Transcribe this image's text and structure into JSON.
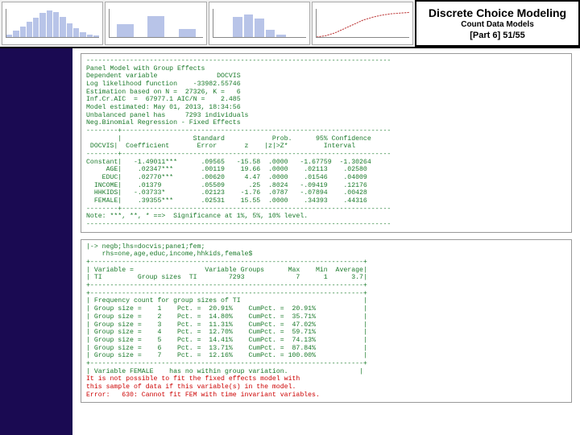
{
  "header": {
    "title": "Discrete Choice Modeling",
    "subtitle": "Count Data Models",
    "part_label": "[Part 6]   51/55"
  },
  "mini_charts": {
    "histogram_heights_pct": [
      10,
      22,
      38,
      55,
      70,
      85,
      95,
      90,
      72,
      50,
      32,
      18,
      10,
      5
    ],
    "bars3_heights_pct": [
      45,
      75,
      28
    ],
    "bars5_heights_pct": [
      72,
      80,
      66,
      25,
      10
    ],
    "line_points": "0,40 10,38 20,34 30,28 40,22 50,16 60,12 70,9 80,7 90,6 100,5"
  },
  "output1": {
    "text": "-----------------------------------------------------------------------------\nPanel Model with Group Effects\nDependent variable               DOCVIS\nLog likelihood function    -33982.55746\nEstimation based on N =  27326, K =   6\nInf.Cr.AIC  =  67977.1 AIC/N =    2.485\nModel estimated: May 01, 2013, 18:34:56\nUnbalanced panel has     7293 individuals\nNeg.Binomial Regression - Fixed Effects\n--------+--------------------------------------------------------------------\n        |                  Standard            Prob.      95% Confidence\n DOCVIS|  Coefficient       Error       z    |z|>Z*         Interval\n--------+--------------------------------------------------------------------\nConstant|   -1.49011***      .09565   -15.58  .0000   -1.67759  -1.30264\n     AGE|    .02347***       .00119    19.66  .0000    .02113    .02580\n    EDUC|    .02770***       .00620     4.47  .0000    .01546    .04009\n  INCOME|    .01379          .05509      .25  .8024   -.09419    .12176\n  HHKIDS|   -.03733*         .02123    -1.76  .0787   -.07894    .00428\n  FEMALE|    .39355***       .02531    15.55  .0000    .34393    .44316\n--------+--------------------------------------------------------------------\nNote: ***, **, * ==>  Significance at 1%, 5%, 10% level.\n-----------------------------------------------------------------------------"
  },
  "output2": {
    "pre": "|-> negb;lhs=docvis;pane1;fem;\n    rhs=one,age,educ,income,hhkids,female$\n+---------------------------------------------------------------------+\n| Variable =                  Variable Groups      Max    Min  Average|\n| TI         Group sizes  TI        7293             7      1      3.7|\n+---------------------------------------------------------------------+\n+---------------------------------------------------------------------+\n| Frequency count for group sizes of TI                               |\n| Group size =    1    Pct. =  20.91%    CumPct. =  20.91%            |\n| Group size =    2    Pct. =  14.80%    CumPct. =  35.71%            |\n| Group size =    3    Pct. =  11.31%    CumPct. =  47.02%            |\n| Group size =    4    Pct. =  12.70%    CumPct. =  59.71%            |\n| Group size =    5    Pct. =  14.41%    CumPct. =  74.13%            |\n| Group size =    6    Pct. =  13.71%    CumPct. =  87.84%            |\n| Group size =    7    Pct. =  12.16%    CumPct. = 100.00%            |\n+---------------------------------------------------------------------+\n| Variable FEMALE    has no within group variation.                  |",
    "err": "It is not possible to fit the fixed effects model with\nthis sample of data if this variable(s) in the model.\nError:   630: Cannot fit FEM with time invariant variables."
  }
}
